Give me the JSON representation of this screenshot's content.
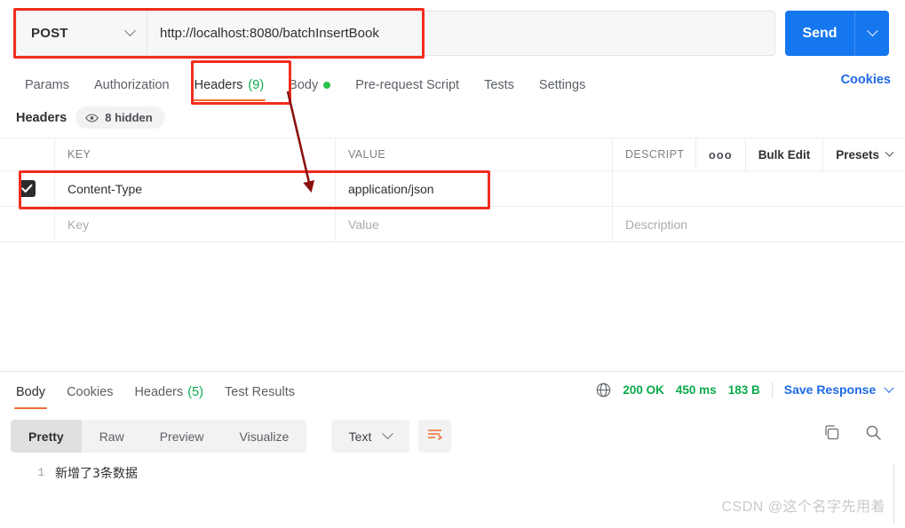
{
  "request": {
    "method": "POST",
    "method_icon": "chevron-down-icon",
    "url": "http://localhost:8080/batchInsertBook",
    "send_label": "Send",
    "send_caret_icon": "chevron-down-icon",
    "tabs": [
      {
        "label": "Params",
        "active": false,
        "badge": "",
        "dot": false
      },
      {
        "label": "Authorization",
        "active": false,
        "badge": "",
        "dot": false
      },
      {
        "label": "Headers",
        "active": true,
        "badge": "(9)",
        "dot": false
      },
      {
        "label": "Body",
        "active": false,
        "badge": "",
        "dot": true
      },
      {
        "label": "Pre-request Script",
        "active": false,
        "badge": "",
        "dot": false
      },
      {
        "label": "Tests",
        "active": false,
        "badge": "",
        "dot": false
      },
      {
        "label": "Settings",
        "active": false,
        "badge": "",
        "dot": false
      }
    ],
    "cookies_link": "Cookies"
  },
  "headers_panel": {
    "section_label": "Headers",
    "hidden_pill": "8 hidden",
    "hidden_pill_icon": "eye-icon",
    "columns": {
      "key": "KEY",
      "value": "VALUE",
      "description": "DESCRIPT"
    },
    "toolbar": {
      "more_label": "ooo",
      "bulk_edit_label": "Bulk Edit",
      "presets_label": "Presets",
      "presets_icon": "chevron-down-icon"
    },
    "rows": [
      {
        "checked": true,
        "key": "Content-Type",
        "value": "application/json",
        "description": ""
      }
    ],
    "placeholder_row": {
      "key": "Key",
      "value": "Value",
      "description": "Description"
    }
  },
  "response": {
    "tabs": [
      {
        "label": "Body",
        "active": true,
        "badge": ""
      },
      {
        "label": "Cookies",
        "active": false,
        "badge": ""
      },
      {
        "label": "Headers",
        "active": false,
        "badge": "(5)"
      },
      {
        "label": "Test Results",
        "active": false,
        "badge": ""
      }
    ],
    "meta": {
      "globe_icon": "globe-icon",
      "status": "200 OK",
      "time": "450 ms",
      "size": "183 B",
      "save_label": "Save Response",
      "save_icon": "chevron-down-icon"
    },
    "format_tabs": [
      {
        "label": "Pretty",
        "active": true
      },
      {
        "label": "Raw",
        "active": false
      },
      {
        "label": "Preview",
        "active": false
      },
      {
        "label": "Visualize",
        "active": false
      }
    ],
    "content_type": "Text",
    "content_type_icon": "chevron-down-icon",
    "wrap_icon": "wrap-lines-icon",
    "copy_icon": "copy-icon",
    "search_icon": "search-icon",
    "body_lines": [
      {
        "number": "1",
        "text": "新增了3条数据"
      }
    ]
  },
  "watermark": "CSDN @这个名字先用着",
  "colors": {
    "accent_orange": "#ef6c36",
    "link_blue": "#1f6ae5",
    "send_blue": "#1577ef",
    "success_green": "#0caa4b",
    "annotation_red": "#f22d1f",
    "arrow_dark_red": "#8c1010"
  }
}
